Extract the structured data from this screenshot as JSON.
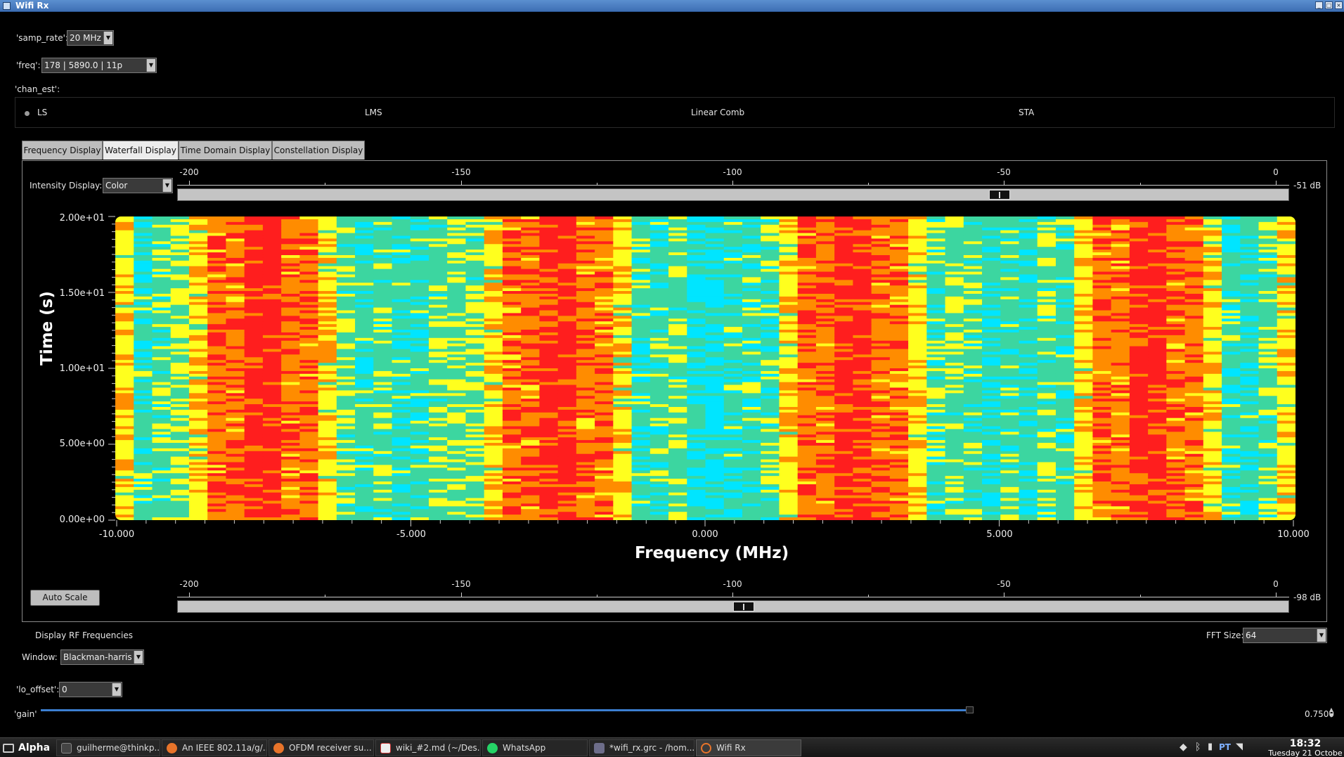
{
  "window": {
    "title": "Wifi Rx"
  },
  "controls": {
    "samp_rate": {
      "label": "'samp_rate':",
      "value": "20 MHz"
    },
    "freq": {
      "label": "'freq':",
      "value": "178 | 5890.0 | 11p"
    },
    "chan_est": {
      "label": "'chan_est':",
      "options": [
        "LS",
        "LMS",
        "Linear Comb",
        "STA"
      ],
      "selected": "LS"
    }
  },
  "tabs": [
    {
      "label": "Frequency Display",
      "active": false
    },
    {
      "label": "Waterfall Display",
      "active": true
    },
    {
      "label": "Time Domain Display",
      "active": false
    },
    {
      "label": "Constellation Display",
      "active": false
    }
  ],
  "waterfall": {
    "intensity_label": "Intensity Display:",
    "intensity_value": "Color",
    "upper_scale": {
      "ticks": [
        "-200",
        "-150",
        "-100",
        "-50",
        "0"
      ],
      "value_label": "-51 dB",
      "value": -51
    },
    "lower_scale": {
      "ticks": [
        "-200",
        "-150",
        "-100",
        "-50",
        "0"
      ],
      "value_label": "-98 dB",
      "value": -98
    },
    "auto_scale_label": "Auto Scale",
    "display_rf_label": "Display RF Frequencies",
    "fft_size_label": "FFT Size:",
    "fft_size_value": "64",
    "window_label": "Window:",
    "window_value": "Blackman-harris"
  },
  "chart_data": {
    "type": "heatmap",
    "xlabel": "Frequency (MHz)",
    "ylabel": "Time (s)",
    "xlim": [
      -10.0,
      10.0
    ],
    "ylim": [
      0.0,
      20.0
    ],
    "x_tick_labels": [
      "-10.000",
      "-5.000",
      "0.000",
      "5.000",
      "10.000"
    ],
    "y_tick_labels": [
      "0.00e+00",
      "5.00e+00",
      "1.00e+01",
      "1.50e+01",
      "2.00e+01"
    ],
    "bins": 64,
    "pilot_frequencies_mhz": [
      -7.5,
      -2.5,
      2.5,
      7.5
    ],
    "colormap": [
      "#00e5ff",
      "#3cd6a0",
      "#ffff1e",
      "#ff8c00",
      "#ff1e1e"
    ]
  },
  "lo_offset": {
    "label": "'lo_offset':",
    "value": "0"
  },
  "gain": {
    "label": "'gain'",
    "value": "0.7500",
    "fraction": 0.75
  },
  "taskbar": {
    "start_label": "Alpha",
    "items": [
      {
        "label": "guilherme@thinkp..."
      },
      {
        "label": "An IEEE 802.11a/g/..."
      },
      {
        "label": "OFDM receiver su..."
      },
      {
        "label": "wiki_#2.md (~/Des..."
      },
      {
        "label": "WhatsApp"
      },
      {
        "label": "*wifi_rx.grc - /hom..."
      },
      {
        "label": "Wifi Rx"
      }
    ],
    "keyboard_layout": "PT",
    "clock_time": "18:32",
    "clock_date": "Tuesday 21 Octobe"
  }
}
